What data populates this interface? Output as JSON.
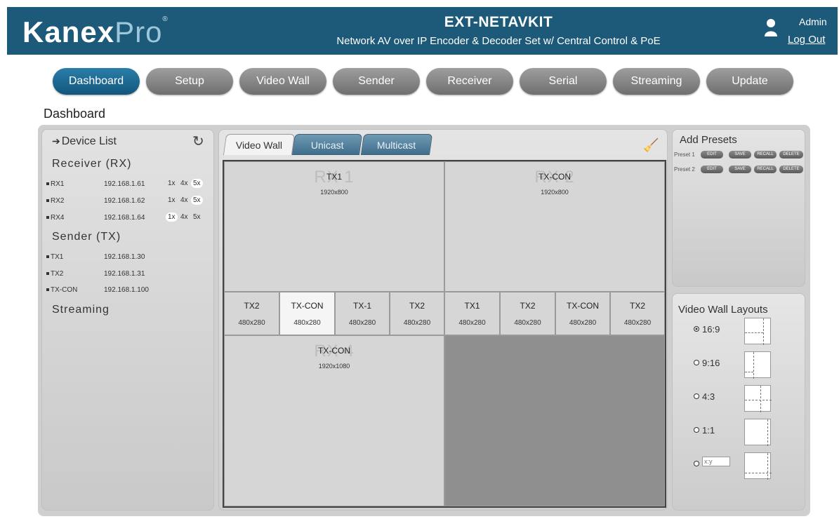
{
  "header": {
    "logo_kanex": "Kanex",
    "logo_pro": "Pro",
    "logo_reg": "®",
    "title": "EXT-NETAVKIT",
    "subtitle": "Network AV over IP Encoder & Decoder Set w/ Central Control & PoE",
    "user": "Admin",
    "logout": "Log Out"
  },
  "nav": [
    "Dashboard",
    "Setup",
    "Video Wall",
    "Sender",
    "Receiver",
    "Serial",
    "Streaming",
    "Update"
  ],
  "page_title": "Dashboard",
  "device_list": {
    "title": "Device List",
    "receiver_title": "Receiver (RX)",
    "receivers": [
      {
        "name": "RX1",
        "ip": "192.168.1.61",
        "scales": [
          "1x",
          "4x",
          "5x"
        ],
        "selected": "5x"
      },
      {
        "name": "RX2",
        "ip": "192.168.1.62",
        "scales": [
          "1x",
          "4x",
          "5x"
        ],
        "selected": "5x"
      },
      {
        "name": "RX4",
        "ip": "192.168.1.64",
        "scales": [
          "1x",
          "4x",
          "5x"
        ],
        "selected": "1x"
      }
    ],
    "sender_title": "Sender (TX)",
    "senders": [
      {
        "name": "TX1",
        "ip": "192.168.1.30"
      },
      {
        "name": "TX2",
        "ip": "192.168.1.31"
      },
      {
        "name": "TX-CON",
        "ip": "192.168.1.100"
      }
    ],
    "streaming_title": "Streaming"
  },
  "tabs": [
    "Video Wall",
    "Unicast",
    "Multicast"
  ],
  "wall": {
    "zones": [
      {
        "ghost": "RX 1",
        "source": "TX1",
        "res": "1920x800"
      },
      {
        "ghost": "RX 2",
        "source": "TX-CON",
        "res": "1920x800"
      },
      {
        "ghost": "RX 4",
        "source": "TX-CON",
        "res": "1920x1080"
      }
    ],
    "cells": [
      {
        "source": "TX2",
        "res": "480x280"
      },
      {
        "source": "TX-CON",
        "res": "480x280"
      },
      {
        "source": "TX-1",
        "res": "480x280"
      },
      {
        "source": "TX2",
        "res": "480x280"
      },
      {
        "source": "TX1",
        "res": "480x280"
      },
      {
        "source": "TX2",
        "res": "480x280"
      },
      {
        "source": "TX-CON",
        "res": "480x280"
      },
      {
        "source": "TX2",
        "res": "480x280"
      }
    ]
  },
  "presets": {
    "title": "Add Presets",
    "rows": [
      {
        "label": "Preset 1",
        "buttons": [
          "EDIT",
          "SAVE",
          "RECALL",
          "DELETE"
        ]
      },
      {
        "label": "Preset 2",
        "buttons": [
          "EDIT",
          "SAVE",
          "RECALL",
          "DELETE"
        ]
      }
    ]
  },
  "layouts": {
    "title": "Video Wall Layouts",
    "options": [
      {
        "label": "16:9",
        "selected": true
      },
      {
        "label": "9:16",
        "selected": false
      },
      {
        "label": "4:3",
        "selected": false
      },
      {
        "label": "1:1",
        "selected": false
      }
    ],
    "custom_placeholder": "x:y"
  },
  "colors": {
    "header_bg": "#1d5a79",
    "nav_active": "#12567c",
    "nav_inactive": "#7f7f7f",
    "tab_inactive": "#4f7f9c"
  }
}
